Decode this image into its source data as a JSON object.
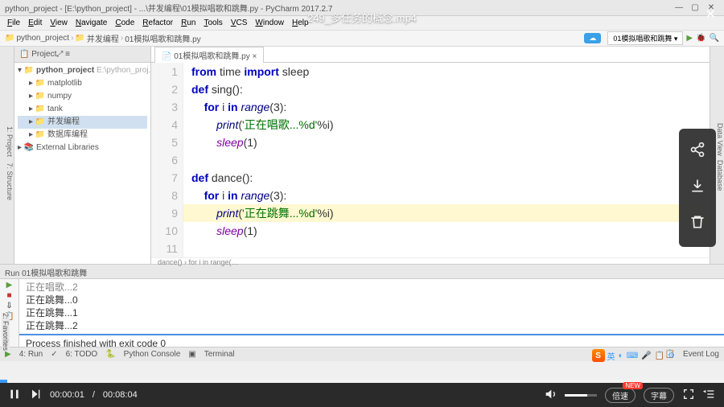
{
  "video": {
    "title": "249_多任务的概念.mp4",
    "current_time": "00:00:01",
    "duration": "00:08:04",
    "speed_label": "倍速",
    "speed_new": "NEW",
    "subtitle_label": "字幕"
  },
  "pycharm": {
    "title_left": "python_project - [E:\\python_project] - ...\\并发编程\\01模拟唱歌和跳舞.py - PyCharm 2017.2.7",
    "menu": [
      "File",
      "Edit",
      "View",
      "Navigate",
      "Code",
      "Refactor",
      "Run",
      "Tools",
      "VCS",
      "Window",
      "Help"
    ],
    "breadcrumbs": [
      "python_project",
      "并发编程",
      "01模拟唱歌和跳舞.py"
    ],
    "run_config": "01模拟唱歌和跳舞",
    "project": {
      "header": "Project",
      "root": "python_project",
      "root_path": "E:\\python_proj...",
      "nodes": [
        "matplotlib",
        "numpy",
        "tank",
        "并发编程",
        "数据库编程"
      ],
      "external": "External Libraries"
    },
    "editor_tab": "01模拟唱歌和跳舞.py",
    "code": {
      "lines": [
        {
          "n": "1",
          "html": "<span class='kw'>from</span> time <span class='kw'>import</span> sleep"
        },
        {
          "n": "2",
          "html": "<span class='kw'>def</span> sing():"
        },
        {
          "n": "3",
          "html": "    <span class='kw'>for</span> i <span class='kw'>in</span> <span class='builtin'>range</span>(3):"
        },
        {
          "n": "4",
          "html": "        <span class='builtin'>print</span>(<span class='str'>'正在唱歌...%d'</span>%i)"
        },
        {
          "n": "5",
          "html": "        <span class='fn'>sleep</span>(1)"
        },
        {
          "n": "6",
          "html": ""
        },
        {
          "n": "7",
          "html": "<span class='kw'>def</span> dance():"
        },
        {
          "n": "8",
          "html": "    <span class='kw'>for</span> i <span class='kw'>in</span> <span class='builtin'>range</span>(3):"
        },
        {
          "n": "9",
          "html": "        <span class='builtin'>print</span>(<span class='str'>'正在跳舞...%d'</span>%i)",
          "hl": true
        },
        {
          "n": "10",
          "html": "        <span class='fn'>sleep</span>(1)"
        },
        {
          "n": "11",
          "html": ""
        }
      ],
      "crumb": "dance()  ›  for i in range(…"
    },
    "run": {
      "header": "Run  01模拟唱歌和跳舞",
      "output": [
        "正在唱歌...2",
        "正在跳舞...0",
        "正在跳舞...1",
        "正在跳舞...2"
      ],
      "exit": "Process finished with exit code 0"
    },
    "bottom_tabs": {
      "run": "4: Run",
      "todo": "6: TODO",
      "console": "Python Console",
      "terminal": "Terminal",
      "event_log": "Event Log"
    },
    "side_right": [
      "Data View",
      "Database"
    ],
    "side_left": [
      "2: Favorites"
    ],
    "ime": {
      "logo": "S",
      "label": "英"
    }
  }
}
